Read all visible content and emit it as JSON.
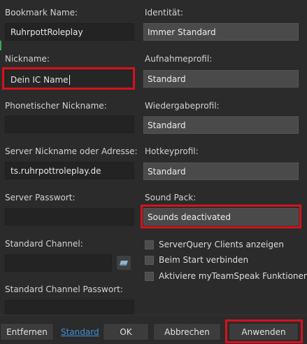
{
  "left": {
    "bookmark_name_label": "Bookmark Name:",
    "bookmark_name_value": "RuhrpottRoleplay",
    "nickname_label": "Nickname:",
    "nickname_value": "Dein IC Name",
    "phonetic_nickname_label": "Phonetischer Nickname:",
    "phonetic_nickname_value": "",
    "server_address_label": "Server Nickname oder Adresse:",
    "server_address_value": "ts.ruhrpottroleplay.de",
    "server_password_label": "Server Passwort:",
    "server_password_value": "",
    "default_channel_label": "Standard Channel:",
    "default_channel_value": "",
    "default_channel_password_label": "Standard Channel Passwort:",
    "default_channel_password_value": ""
  },
  "right": {
    "identity_label": "Identität:",
    "identity_value": "Immer Standard",
    "capture_profile_label": "Aufnahmeprofil:",
    "capture_profile_value": "Standard",
    "playback_profile_label": "Wiedergabeprofil:",
    "playback_profile_value": "Standard",
    "hotkey_profile_label": "Hotkeyprofil:",
    "hotkey_profile_value": "Standard",
    "sound_pack_label": "Sound Pack:",
    "sound_pack_value": "Sounds deactivated",
    "checkboxes": [
      {
        "label": "ServerQuery Clients anzeigen",
        "checked": false
      },
      {
        "label": "Beim Start verbinden",
        "checked": false
      },
      {
        "label": "Aktiviere myTeamSpeak Funktionen",
        "checked": false
      }
    ]
  },
  "footer": {
    "remove_label": "Entfernen",
    "default_link": "Standard",
    "ok_label": "OK",
    "cancel_label": "Abbrechen",
    "apply_label": "Anwenden"
  },
  "colors": {
    "highlight": "#d8101c",
    "background": "#2b2b2b",
    "link": "#3f8fd6"
  }
}
